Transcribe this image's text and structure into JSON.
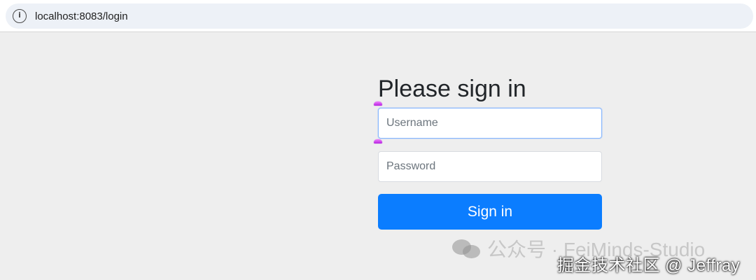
{
  "browser": {
    "url": "localhost:8083/login",
    "info_icon_glyph": "i",
    "info_icon": "info-icon"
  },
  "login": {
    "title": "Please sign in",
    "username_placeholder": "Username",
    "password_placeholder": "Password",
    "submit_label": "Sign in"
  },
  "watermarks": {
    "wechat_text": "公众号 · FeiMinds-Studio",
    "juejin_text": "掘金技术社区 @ Jeffray",
    "wechat_icon": "wechat-icon"
  },
  "colors": {
    "page_background": "#eeeeee",
    "address_bar": "#edf1f7",
    "primary_button": "#0b7dff",
    "focus_border": "#86b7fe",
    "marker_purple": "#c43ce8"
  }
}
